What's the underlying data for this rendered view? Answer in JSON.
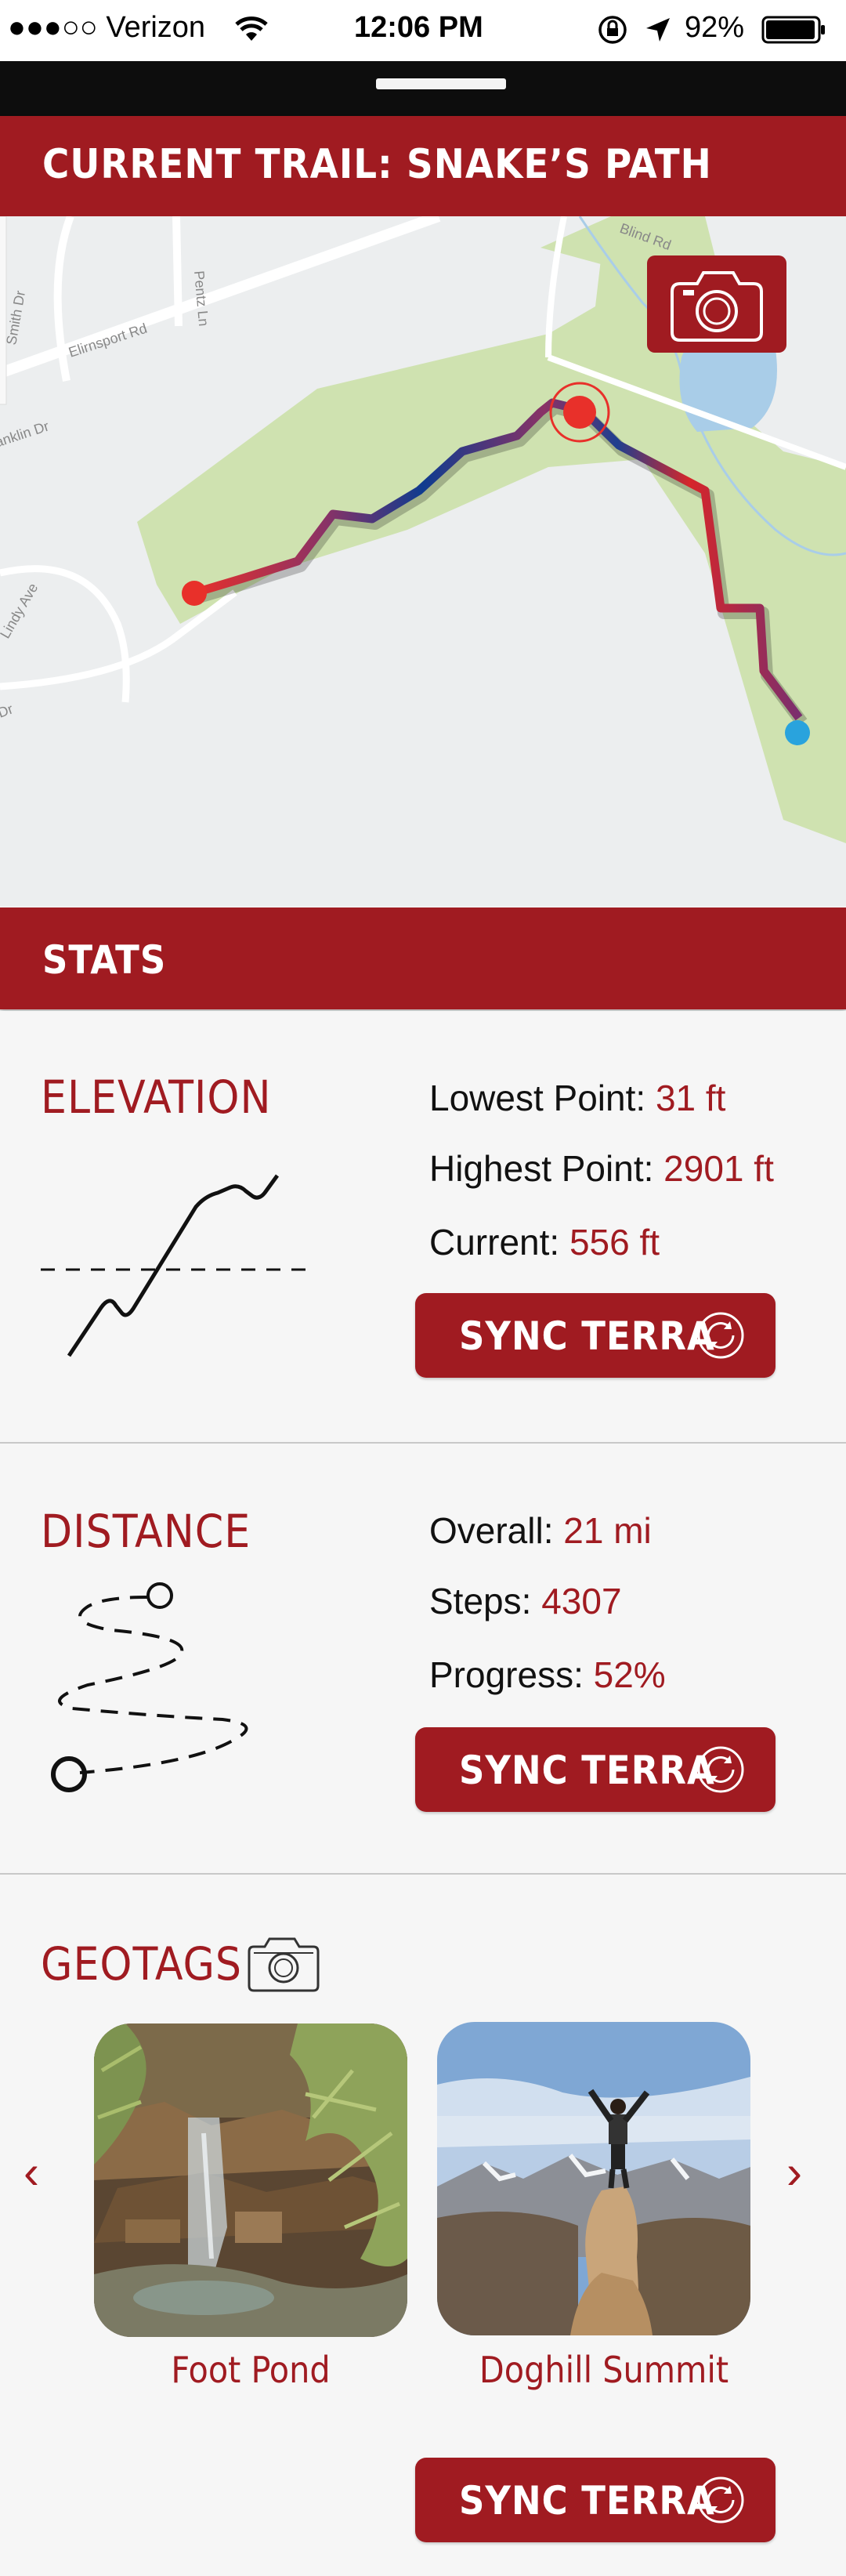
{
  "status_bar": {
    "carrier": "●●●○○ Verizon",
    "time": "12:06 PM",
    "battery": "92%"
  },
  "trail": {
    "title": "CURRENT TRAIL: SNAKE’S PATH"
  },
  "map": {
    "streets": [
      "Smith Dr",
      "Pentz Ln",
      "Elirnsport Rd",
      "Franklin Dr",
      "Lindy Ave",
      "Dr",
      "Blind Rd"
    ]
  },
  "stats": {
    "title": "STATS"
  },
  "elevation": {
    "title": "ELEVATION",
    "lowest_label": "Lowest Point: ",
    "lowest_value": "31 ft",
    "highest_label": "Highest Point: ",
    "highest_value": "2901 ft",
    "current_label": "Current: ",
    "current_value": "556 ft",
    "sync_label": "SYNC TERRA"
  },
  "distance": {
    "title": "DISTANCE",
    "overall_label": "Overall: ",
    "overall_value": "21 mi",
    "steps_label": "Steps: ",
    "steps_value": "4307",
    "progress_label": "Progress: ",
    "progress_value": "52%",
    "sync_label": "SYNC TERRA"
  },
  "geotags": {
    "title": "GEOTAGS",
    "items": [
      {
        "caption": "Foot Pond"
      },
      {
        "caption": "Doghill Summit"
      }
    ],
    "sync_label": "SYNC TERRA"
  },
  "colors": {
    "accent": "#a01b21",
    "park": "#cfe2b0",
    "route_start": "#e8302a",
    "route_end": "#29a3dd"
  }
}
